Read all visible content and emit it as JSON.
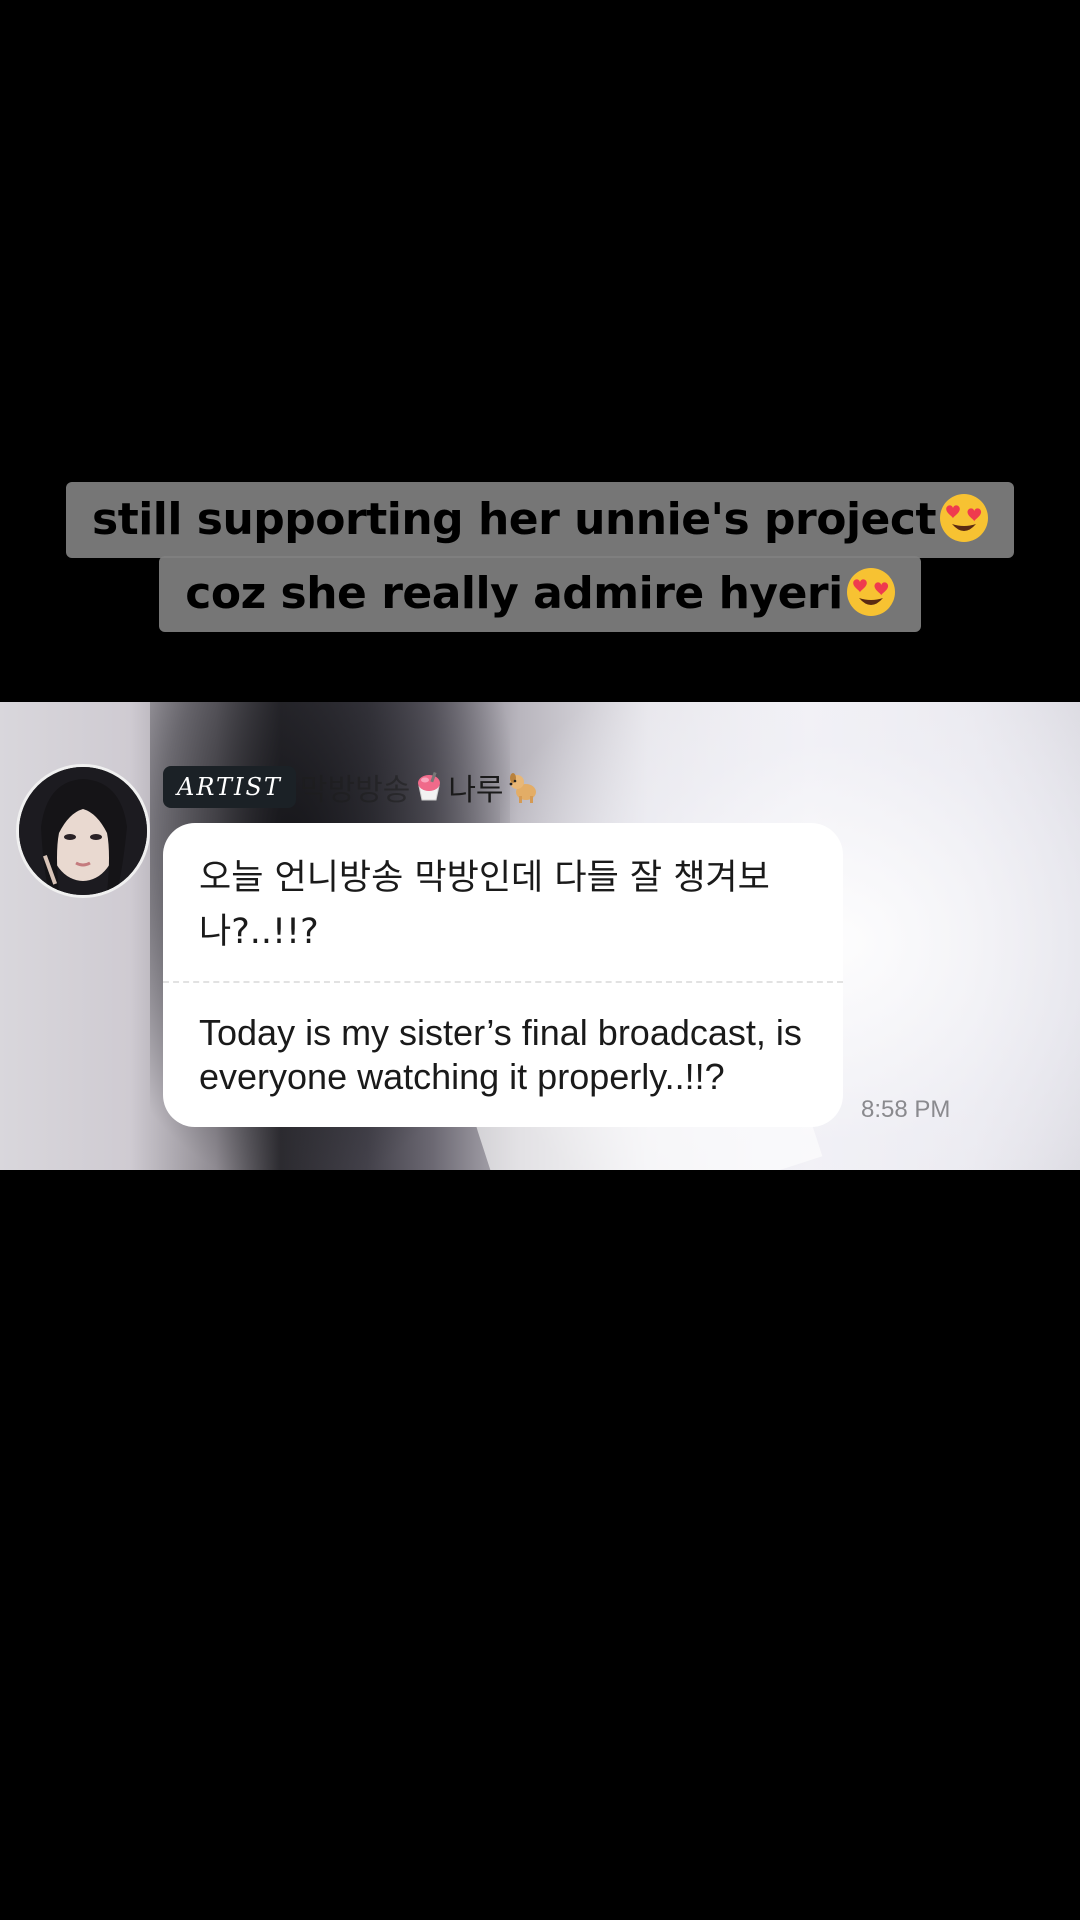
{
  "caption": {
    "line1": "still supporting her unnie's project",
    "line1_emoji": "heart-eyes-emoji",
    "line2": "coz she really admire hyeri",
    "line2_emoji": "heart-eyes-emoji"
  },
  "message": {
    "avatar": "avatar-photo",
    "badge": "ARTIST",
    "sender_prefix": "막방방송",
    "sender_icon_1": "shaved-ice-icon",
    "sender_name": "나루",
    "sender_icon_2": "dog-icon",
    "text_ko": "오늘 언니방송 막방인데 다들 잘 챙겨보나?..!!?",
    "text_en": "Today is my sister’s final broadcast, is everyone watching it properly..!!?",
    "time": "8:58 PM"
  },
  "colors": {
    "background": "#000000",
    "caption_bg": "#808080",
    "bubble_bg": "#ffffff",
    "badge_bg": "#1b2126",
    "timestamp": "#8a8a8e"
  }
}
